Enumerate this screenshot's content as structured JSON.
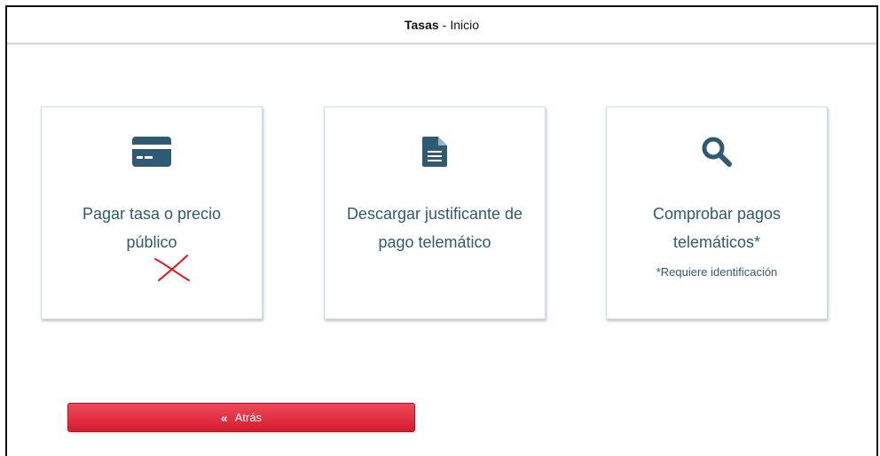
{
  "header": {
    "title_strong": "Tasas",
    "separator": "-",
    "title_rest": "Inicio"
  },
  "cards": [
    {
      "icon": "credit-card-icon",
      "title": "Pagar tasa o precio público",
      "mark": "red-cross-mark"
    },
    {
      "icon": "document-icon",
      "title": "Descargar justificante de pago telemático"
    },
    {
      "icon": "search-icon",
      "title": "Comprobar pagos telemáticos*",
      "note": "*Requiere identificación"
    }
  ],
  "back_button": {
    "icon": "double-chevron-left-icon",
    "chevron": "«",
    "label": "Atrás"
  },
  "colors": {
    "icon": "#2f5a73",
    "card_border": "#bfe3ee",
    "button_red": "#e11d33",
    "cross_red": "#e8141f"
  }
}
